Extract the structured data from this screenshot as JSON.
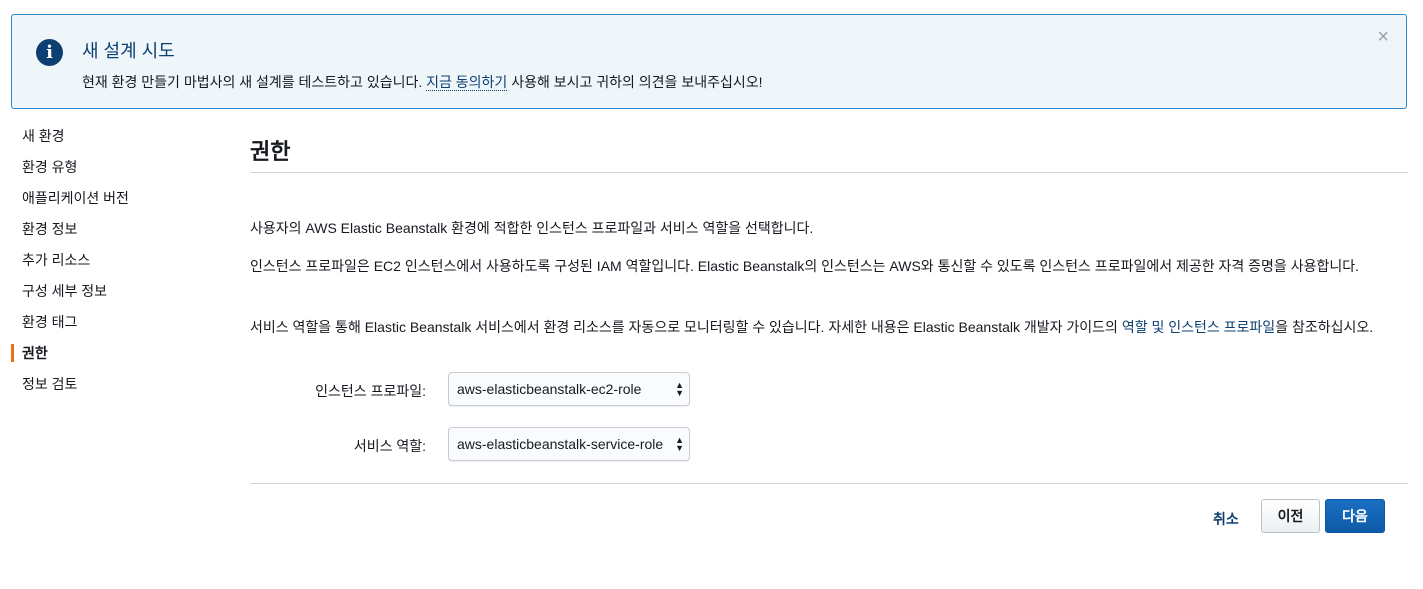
{
  "banner": {
    "title": "새 설계 시도",
    "text_before": "현재 환경 만들기 마법사의 새 설계를 테스트하고 있습니다. ",
    "link": "지금 동의하기",
    "text_after": " 사용해 보시고 귀하의 의견을 보내주십시오!",
    "close": "×",
    "icon": "i"
  },
  "sidebar": {
    "items": [
      {
        "label": "새 환경"
      },
      {
        "label": "환경 유형"
      },
      {
        "label": "애플리케이션 버전"
      },
      {
        "label": "환경 정보"
      },
      {
        "label": "추가 리소스"
      },
      {
        "label": "구성 세부 정보"
      },
      {
        "label": "환경 태그"
      },
      {
        "label": "권한"
      },
      {
        "label": "정보 검토"
      }
    ],
    "active_index": 7
  },
  "main": {
    "heading": "권한",
    "p1": "사용자의 AWS Elastic Beanstalk 환경에 적합한 인스턴스 프로파일과 서비스 역할을 선택합니다.",
    "p2": "인스턴스 프로파일은 EC2 인스턴스에서 사용하도록 구성된 IAM 역할입니다. Elastic Beanstalk의 인스턴스는 AWS와 통신할 수 있도록 인스턴스 프로파일에서 제공한 자격 증명을 사용합니다.",
    "p3_before": "서비스 역할을 통해 Elastic Beanstalk 서비스에서 환경 리소스를 자동으로 모니터링할 수 있습니다. 자세한 내용은 Elastic Beanstalk 개발자 가이드의 ",
    "p3_link": "역할 및 인스턴스 프로파일",
    "p3_after": "을 참조하십시오.",
    "instance_profile_label": "인스턴스 프로파일:",
    "instance_profile_value": "aws-elasticbeanstalk-ec2-role",
    "service_role_label": "서비스 역할:",
    "service_role_value": "aws-elasticbeanstalk-service-role"
  },
  "buttons": {
    "cancel": "취소",
    "previous": "이전",
    "next": "다음"
  },
  "colors": {
    "accent": "#ec7211",
    "link": "#0d3f73",
    "primary_button": "#1166bb",
    "banner_bg": "#eff6fa",
    "banner_border": "#2e8ac9"
  }
}
